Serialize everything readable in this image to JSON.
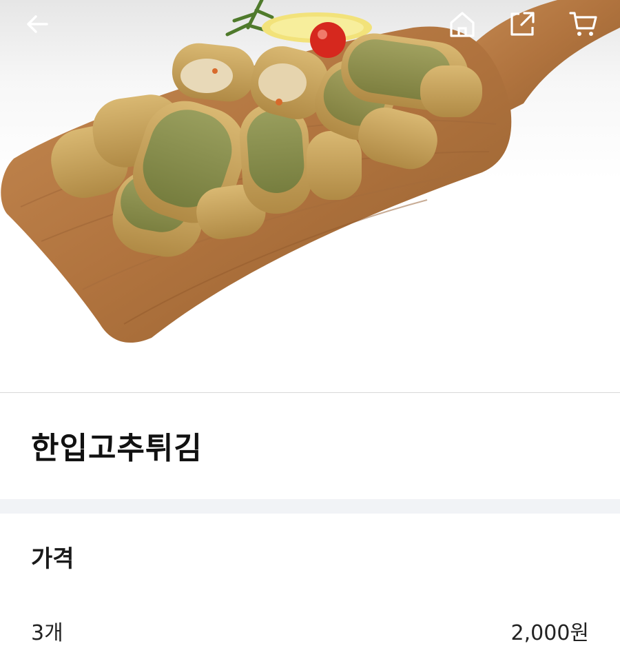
{
  "header": {
    "back_icon": "arrow-left-icon",
    "home_icon": "home-icon",
    "share_icon": "share-icon",
    "cart_icon": "cart-icon",
    "icon_color": "#ffffff"
  },
  "product": {
    "image_icon": "fried-chili-peppers-on-cutting-board",
    "title": "한입고추튀김"
  },
  "price": {
    "heading": "가격",
    "options": [
      {
        "quantity": "3개",
        "price": "2,000원"
      }
    ]
  },
  "colors": {
    "divider": "#f1f3f6",
    "text": "#111111",
    "board": "#b57a45"
  }
}
